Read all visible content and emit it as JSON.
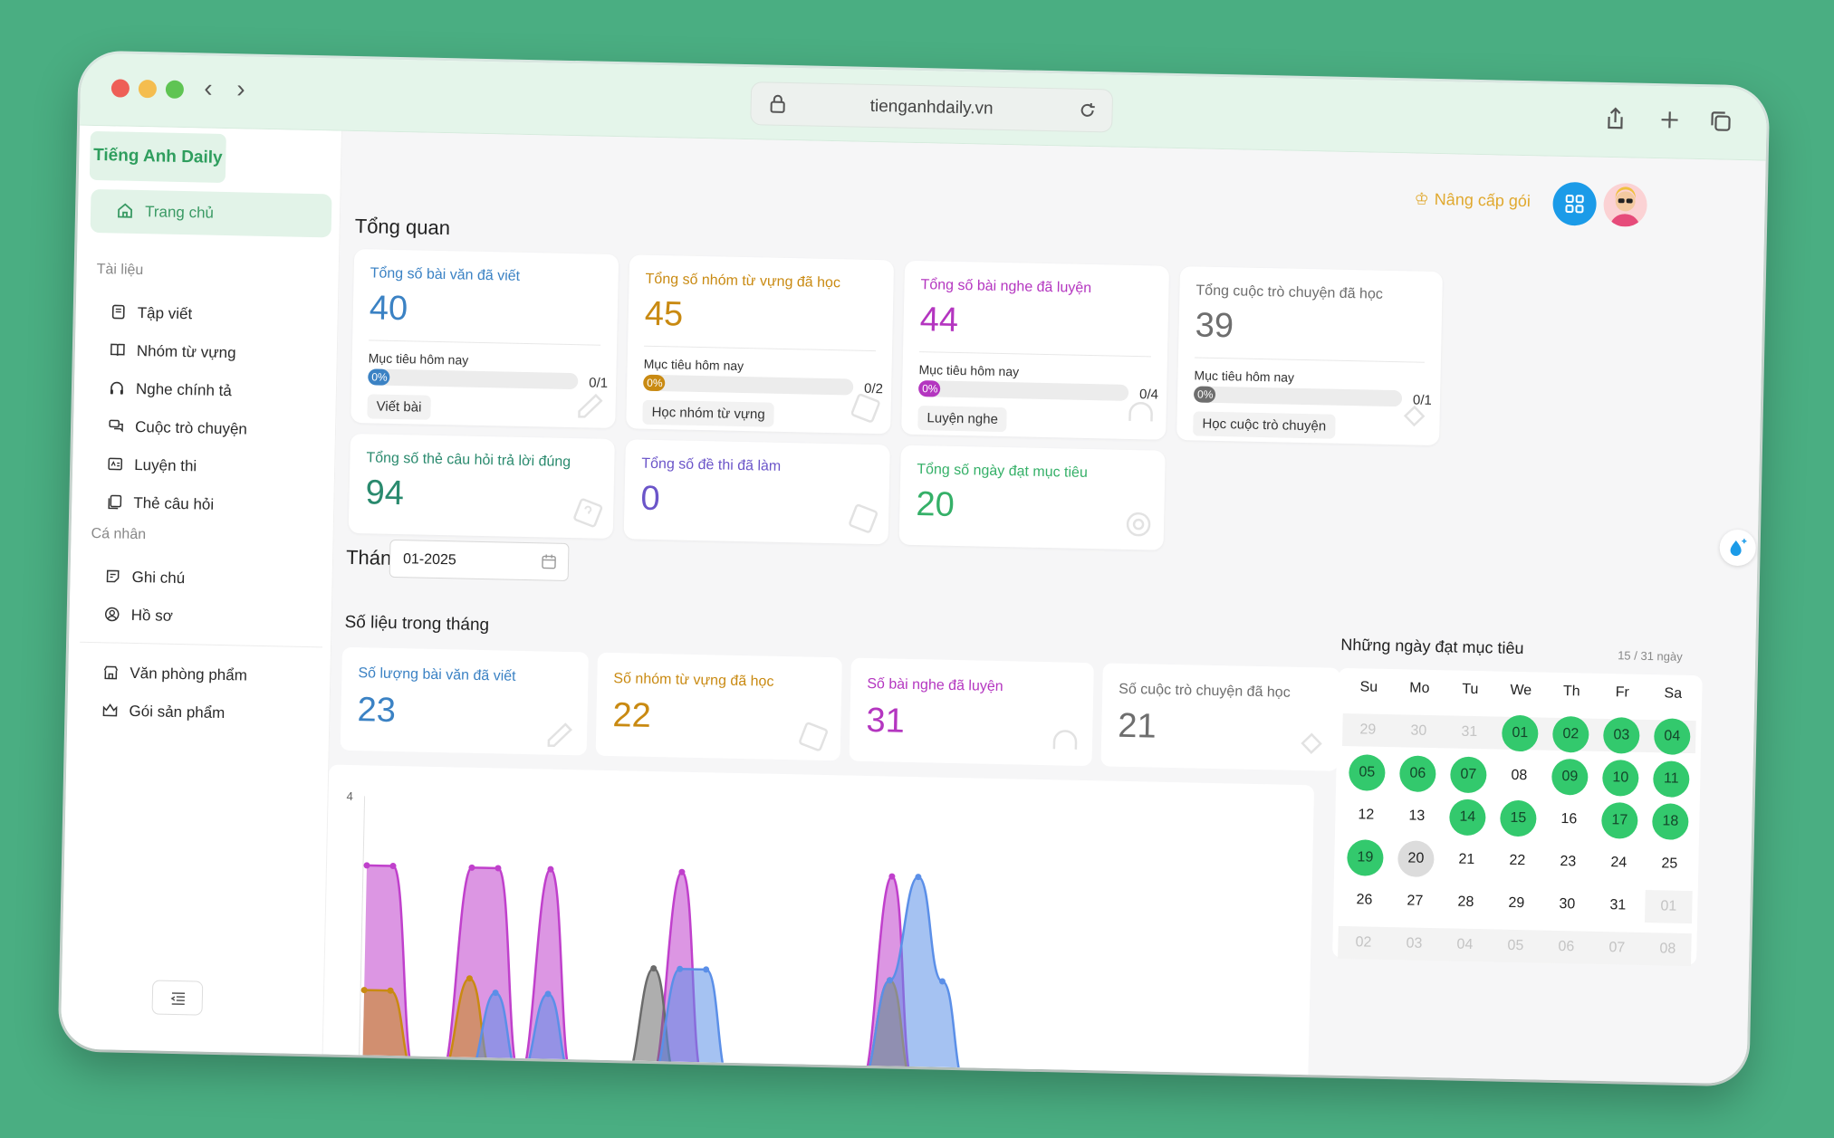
{
  "browser": {
    "url": "tienganhdaily.vn"
  },
  "brand": {
    "name": "Tiếng Anh Daily"
  },
  "sidebar": {
    "home": {
      "label": "Trang chủ",
      "icon": "home-icon"
    },
    "section_docs": "Tài liệu",
    "docs": [
      {
        "label": "Tập viết",
        "icon": "pencil-icon"
      },
      {
        "label": "Nhóm từ vựng",
        "icon": "book-icon"
      },
      {
        "label": "Nghe chính tả",
        "icon": "headphone-icon"
      },
      {
        "label": "Cuộc trò chuyện",
        "icon": "chat-icon"
      },
      {
        "label": "Luyện thi",
        "icon": "exam-icon"
      },
      {
        "label": "Thẻ câu hỏi",
        "icon": "card-icon"
      }
    ],
    "section_personal": "Cá nhân",
    "personal": [
      {
        "label": "Ghi chú",
        "icon": "note-icon"
      },
      {
        "label": "Hồ sơ",
        "icon": "profile-icon"
      }
    ],
    "extra": [
      {
        "label": "Văn phòng phẩm",
        "icon": "store-icon"
      },
      {
        "label": "Gói sản phẩm",
        "icon": "package-icon"
      }
    ]
  },
  "header": {
    "upgrade": "Nâng cấp gói"
  },
  "overview": {
    "title": "Tổng quan",
    "goal_label": "Mục tiêu hôm nay",
    "cards": [
      {
        "title": "Tổng số bài văn đã viết",
        "value": "40",
        "progress": "0%",
        "frac": "0/1",
        "action": "Viết bài",
        "color": "#3b82c4"
      },
      {
        "title": "Tổng số nhóm từ vựng đã học",
        "value": "45",
        "progress": "0%",
        "frac": "0/2",
        "action": "Học nhóm từ vựng",
        "color": "#c98a12"
      },
      {
        "title": "Tổng số bài nghe đã luyện",
        "value": "44",
        "progress": "0%",
        "frac": "0/4",
        "action": "Luyện nghe",
        "color": "#b436c0"
      },
      {
        "title": "Tổng cuộc trò chuyện đã học",
        "value": "39",
        "progress": "0%",
        "frac": "0/1",
        "action": "Học cuộc trò chuyện",
        "color": "#6e6e6e"
      }
    ],
    "cards2": [
      {
        "title": "Tổng số thẻ câu hỏi trả lời đúng",
        "value": "94",
        "color": "#2a8a6e"
      },
      {
        "title": "Tổng số đề thi đã làm",
        "value": "0",
        "color": "#6b55c9"
      },
      {
        "title": "Tổng số ngày đạt mục tiêu",
        "value": "20",
        "color": "#35b068"
      }
    ]
  },
  "month": {
    "label": "Tháng",
    "value": "01-2025"
  },
  "monthly": {
    "title": "Số liệu trong tháng",
    "stats": [
      {
        "title": "Số lượng bài văn đã viết",
        "value": "23",
        "color": "#3b82c4"
      },
      {
        "title": "Số nhóm từ vựng đã học",
        "value": "22",
        "color": "#c98a12"
      },
      {
        "title": "Số bài nghe đã luyện",
        "value": "31",
        "color": "#b436c0"
      },
      {
        "title": "Số cuộc trò chuyện đã học",
        "value": "21",
        "color": "#6e6e6e"
      }
    ]
  },
  "calendar": {
    "title": "Những ngày đạt mục tiêu",
    "count": "15 / 31 ngày",
    "weekdays": [
      "Su",
      "Mo",
      "Tu",
      "We",
      "Th",
      "Fr",
      "Sa"
    ],
    "weeks": [
      [
        "29",
        "30",
        "31",
        "01",
        "02",
        "03",
        "04"
      ],
      [
        "05",
        "06",
        "07",
        "08",
        "09",
        "10",
        "11"
      ],
      [
        "12",
        "13",
        "14",
        "15",
        "16",
        "17",
        "18"
      ],
      [
        "19",
        "20",
        "21",
        "22",
        "23",
        "24",
        "25"
      ],
      [
        "26",
        "27",
        "28",
        "29",
        "30",
        "31",
        "01"
      ],
      [
        "02",
        "03",
        "04",
        "05",
        "06",
        "07",
        "08"
      ]
    ],
    "met_days": [
      "01",
      "02",
      "03",
      "04",
      "05",
      "06",
      "07",
      "09",
      "10",
      "11",
      "14",
      "15",
      "17",
      "18",
      "19"
    ],
    "today": "20"
  },
  "chart_data": {
    "type": "area",
    "ylim": [
      0,
      4
    ],
    "yticks": [
      "4"
    ],
    "x": [
      1,
      2,
      3,
      4,
      5,
      6,
      7,
      8,
      9,
      10,
      11,
      12,
      13,
      14,
      15,
      16,
      17,
      18,
      19,
      20,
      21,
      22,
      23,
      24,
      25,
      26,
      27,
      28,
      29,
      30,
      31
    ],
    "series": [
      {
        "color": "#c040cc",
        "values": [
          3,
          3,
          0,
          0,
          3,
          3,
          0,
          3,
          0,
          0,
          0,
          0,
          3,
          0,
          0,
          0,
          0,
          0,
          0,
          0,
          3,
          0,
          0,
          0,
          0,
          0,
          0,
          0,
          0,
          0,
          0
        ]
      },
      {
        "color": "#c98a12",
        "values": [
          1.2,
          1.2,
          0,
          0,
          1.4,
          0,
          0,
          0,
          0,
          0,
          0,
          0,
          0,
          0,
          0,
          0,
          0,
          0,
          0,
          0,
          1.5,
          0,
          0,
          0,
          0,
          0,
          0,
          0,
          0,
          0,
          0
        ]
      },
      {
        "color": "#6b6b6b",
        "values": [
          0,
          0,
          0,
          0,
          0,
          0,
          0,
          0,
          0,
          0,
          0,
          1.6,
          0,
          0,
          0,
          0,
          0,
          0,
          0,
          0,
          0,
          0,
          0,
          0,
          0,
          0,
          0,
          0,
          0,
          0,
          0
        ]
      },
      {
        "color": "#5b8fe8",
        "values": [
          0,
          0,
          0,
          0,
          0,
          1.2,
          0,
          1.2,
          0,
          0,
          0,
          0,
          1.6,
          1.6,
          0,
          0,
          0,
          0,
          0,
          0,
          1.5,
          3,
          1.5,
          0,
          0,
          0,
          0,
          0,
          0,
          0,
          0
        ]
      }
    ]
  }
}
